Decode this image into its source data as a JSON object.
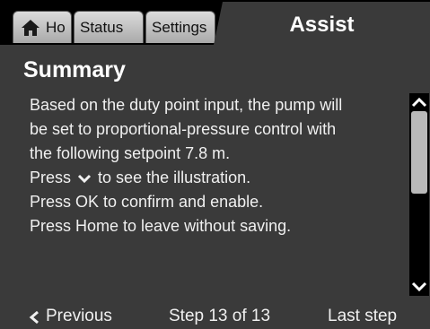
{
  "tabs": {
    "home_label": "Ho",
    "status_label": "Status",
    "settings_label": "Settings",
    "active_label": "Assist"
  },
  "content": {
    "title": "Summary",
    "lines": [
      "Based on the duty point input, the pump will",
      "be set to proportional-pressure control with",
      "the following setpoint  7.8 m.",
      "",
      "Press OK to confirm and enable.",
      "Press Home to leave without saving."
    ],
    "press_prefix": "Press",
    "press_suffix": "to see the illustration."
  },
  "footer": {
    "previous_label": "Previous",
    "step_label": "Step 13 of 13",
    "last_step_label": "Last step"
  },
  "colors": {
    "background": "#3a3a3a",
    "tabbar": "#000000",
    "text": "#f0f0f0",
    "scroll_thumb": "#b9b9b9"
  },
  "icons": {
    "home": "home-icon",
    "down_chevron": "chevron-down-icon",
    "scroll_up": "chevron-up-icon",
    "scroll_down": "chevron-down-icon",
    "previous": "chevron-left-icon"
  },
  "scroll": {
    "position_fraction": 0.0,
    "visible_fraction": 0.45
  }
}
